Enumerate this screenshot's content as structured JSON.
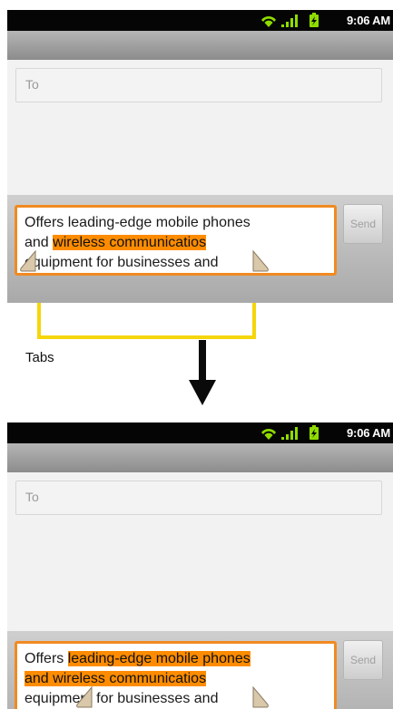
{
  "status_bar": {
    "time": "9:06 AM"
  },
  "compose": {
    "to_placeholder": "To",
    "send_label": "Send"
  },
  "before": {
    "line1": "Offers leading-edge mobile phones",
    "line2_plain": "and ",
    "line2_selected": "wireless communicatios",
    "line3": "equipment for businesses and"
  },
  "after": {
    "line1_plain": "Offers ",
    "line1_selected": "leading-edge mobile phones",
    "line2_selected": "and wireless communicatios",
    "line3": "equipment for businesses and"
  },
  "annotation": {
    "label": "Tabs"
  },
  "colors": {
    "selection": "#ff8c00",
    "focus_border": "#f18a21",
    "annotation": "#f5d60a"
  }
}
